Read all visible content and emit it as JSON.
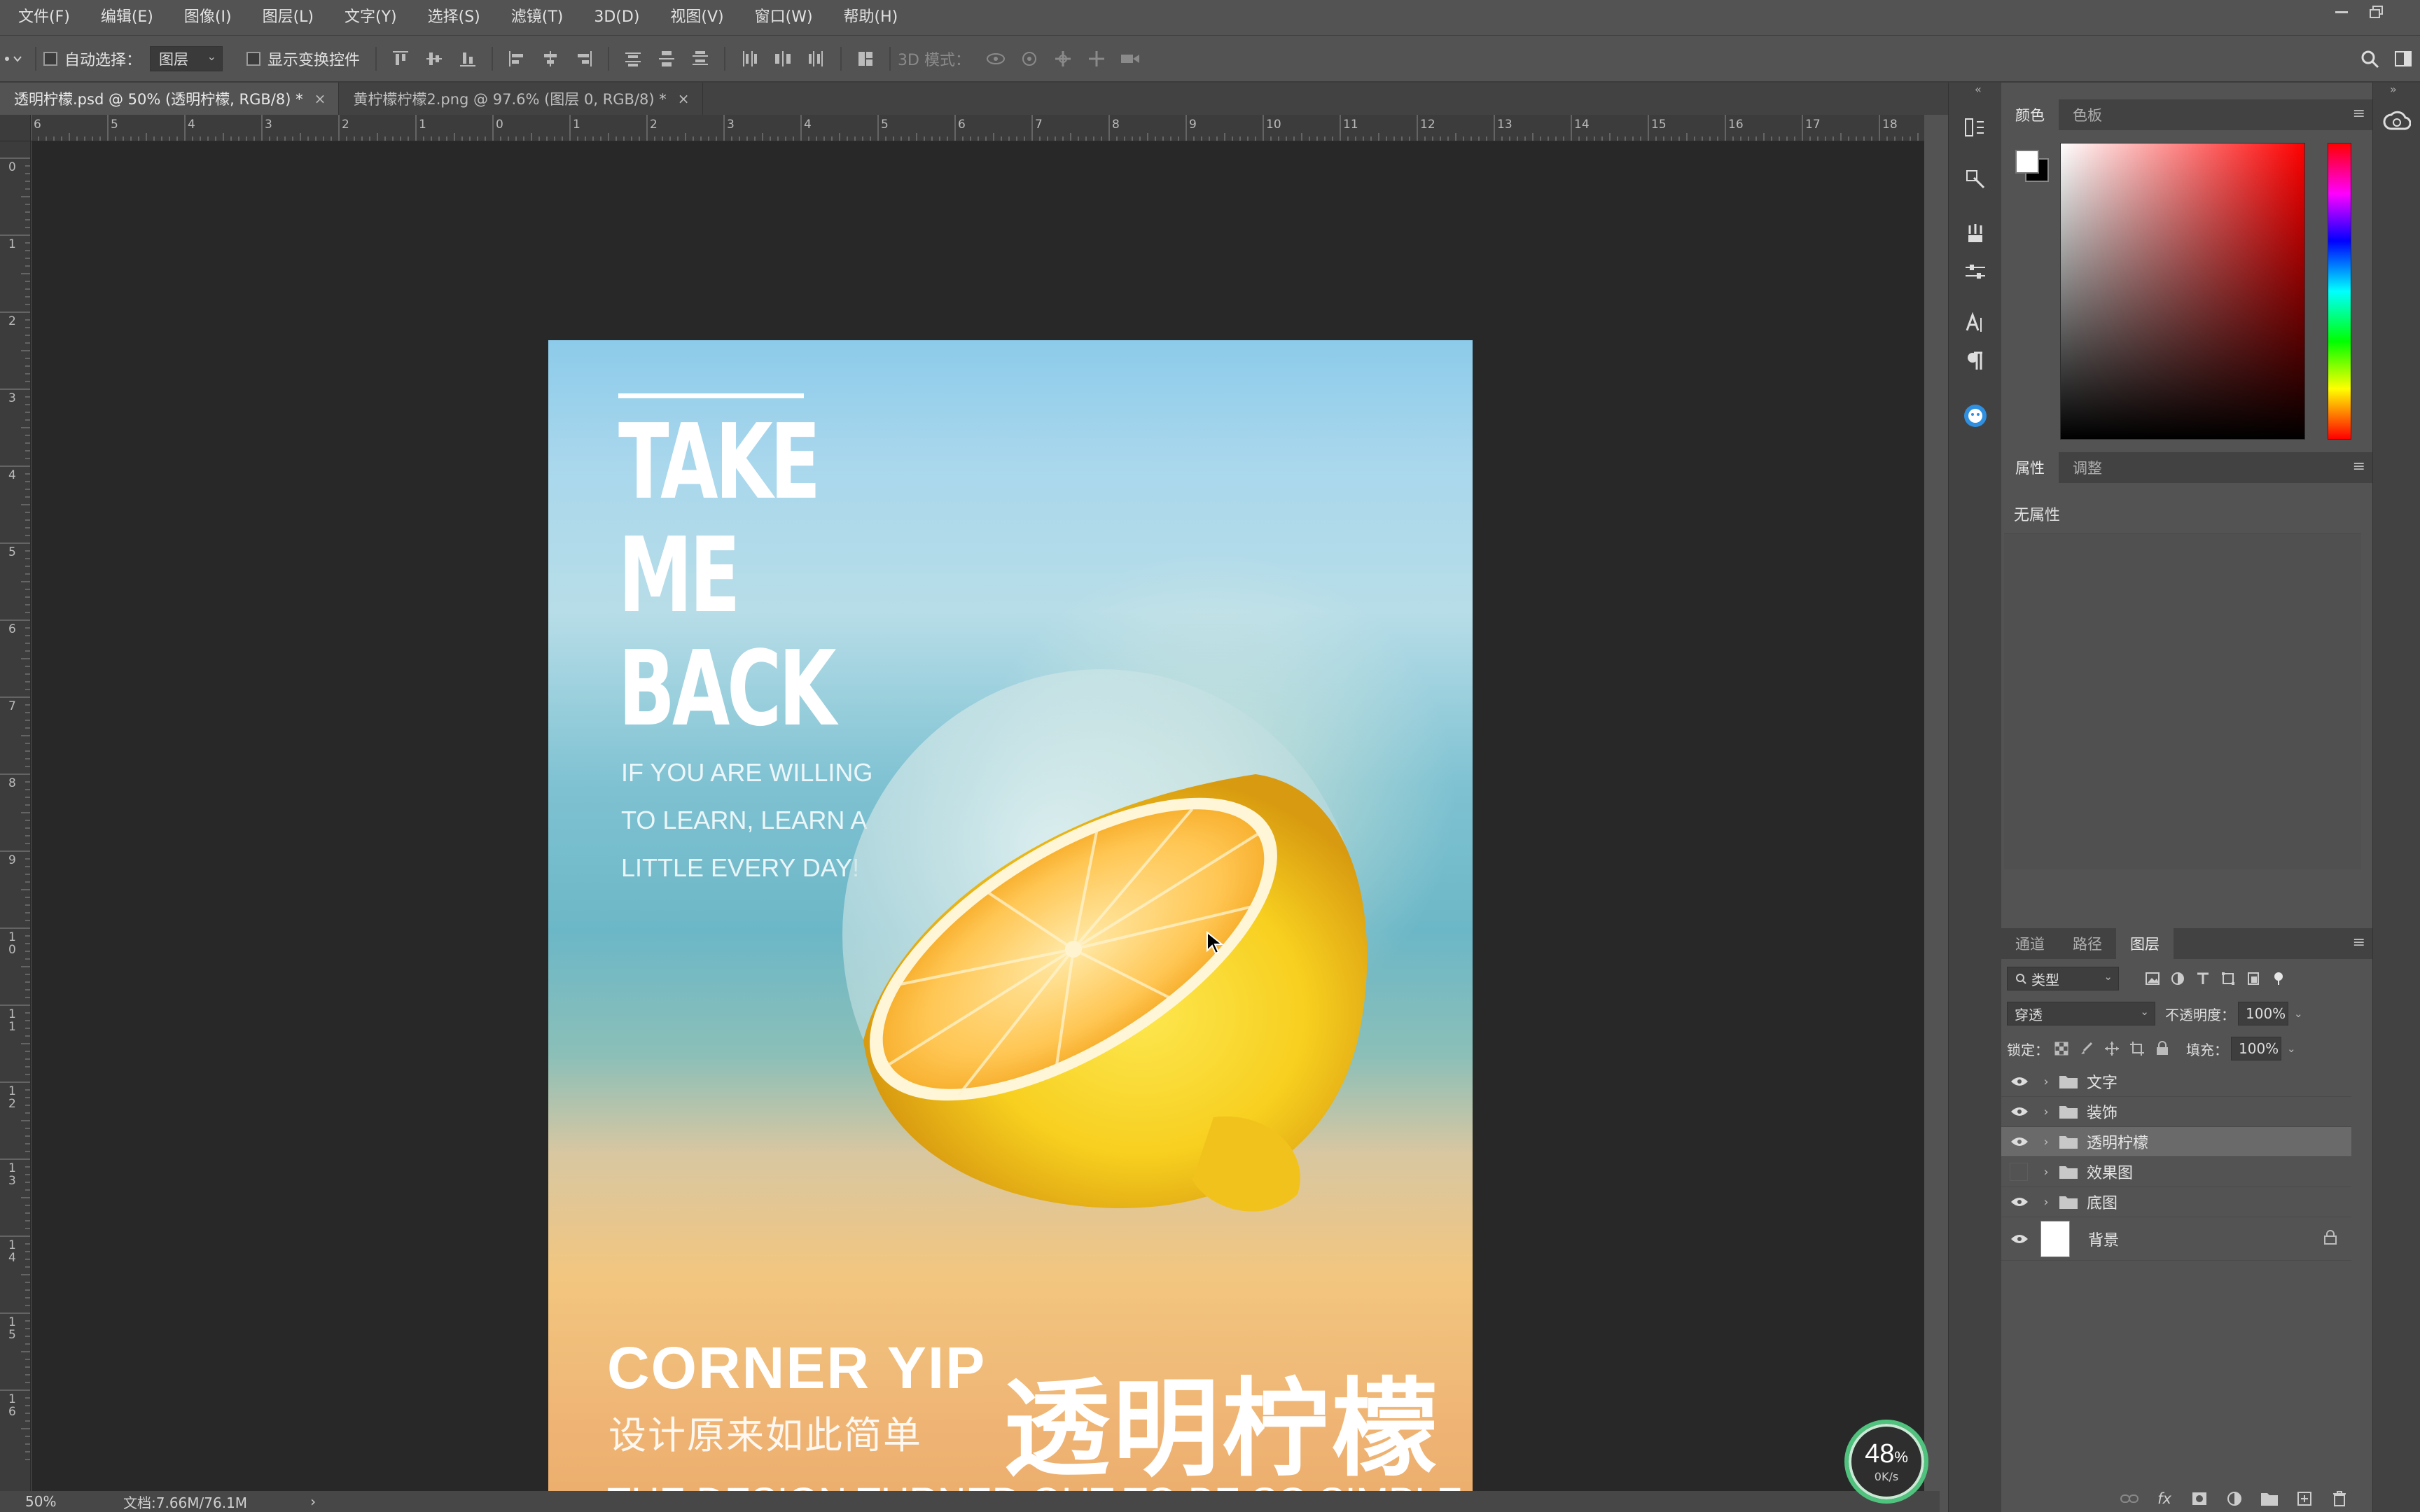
{
  "menubar": {
    "items": [
      "文件(F)",
      "编辑(E)",
      "图像(I)",
      "图层(L)",
      "文字(Y)",
      "选择(S)",
      "滤镜(T)",
      "3D(D)",
      "视图(V)",
      "窗口(W)",
      "帮助(H)"
    ]
  },
  "options_bar": {
    "auto_select_label": "自动选择：",
    "auto_select_value": "图层",
    "show_transform_label": "显示变换控件",
    "mode_3d_label": "3D 模式："
  },
  "doc_tabs": [
    {
      "label": "透明柠檬.psd @ 50% (透明柠檬, RGB/8) *",
      "close": "×"
    },
    {
      "label": "黄柠檬柠檬2.png @ 97.6% (图层 0, RGB/8) *",
      "close": "×"
    }
  ],
  "ruler": {
    "top": [
      "6",
      "5",
      "4",
      "3",
      "2",
      "1",
      "0",
      "1",
      "2",
      "3",
      "4",
      "5",
      "6",
      "7",
      "8",
      "9",
      "10",
      "11",
      "12",
      "13",
      "14",
      "15",
      "16",
      "17",
      "18"
    ],
    "left": [
      "0",
      "1",
      "2",
      "3",
      "4",
      "5",
      "6",
      "7",
      "8",
      "9",
      "10",
      "11",
      "12",
      "13",
      "14",
      "15",
      "16"
    ]
  },
  "poster": {
    "line1": "TAKE",
    "line2": "ME",
    "line3": "BACK",
    "quote1": "IF YOU ARE WILLING",
    "quote2": "TO LEARN, LEARN A",
    "quote3": "LITTLE EVERY DAY!",
    "brand": "CORNER YIP",
    "sub_cn": "设计原来如此简单",
    "title_cn": "透明柠檬",
    "tagline": "THE DESIGN TURNED OUT TO BE SO SIMPLE"
  },
  "status": {
    "zoom": "50%",
    "doc_info": "文档:7.66M/76.1M",
    "arrow": "›"
  },
  "perf": {
    "percent": "48",
    "unit": "%",
    "rate": "0K/s"
  },
  "color_panel": {
    "tabs": [
      "颜色",
      "色板"
    ]
  },
  "props_panel": {
    "tabs": [
      "属性",
      "调整"
    ],
    "empty": "无属性"
  },
  "layers_panel": {
    "tabs": [
      "通道",
      "路径",
      "图层"
    ],
    "filter_label": "类型",
    "blend_mode": "穿透",
    "opacity_label": "不透明度：",
    "opacity_value": "100%",
    "lock_label": "锁定：",
    "fill_label": "填充：",
    "fill_value": "100%",
    "layers": [
      {
        "name": "文字",
        "visible": true
      },
      {
        "name": "装饰",
        "visible": true
      },
      {
        "name": "透明柠檬",
        "visible": true
      },
      {
        "name": "效果图",
        "visible": false
      },
      {
        "name": "底图",
        "visible": true
      }
    ],
    "background_layer": "背景",
    "footer_fx": "fx"
  },
  "colors": {
    "panel_bg": "#535353",
    "canvas_bg": "#282828",
    "perf_ring": "#4fc27d"
  }
}
